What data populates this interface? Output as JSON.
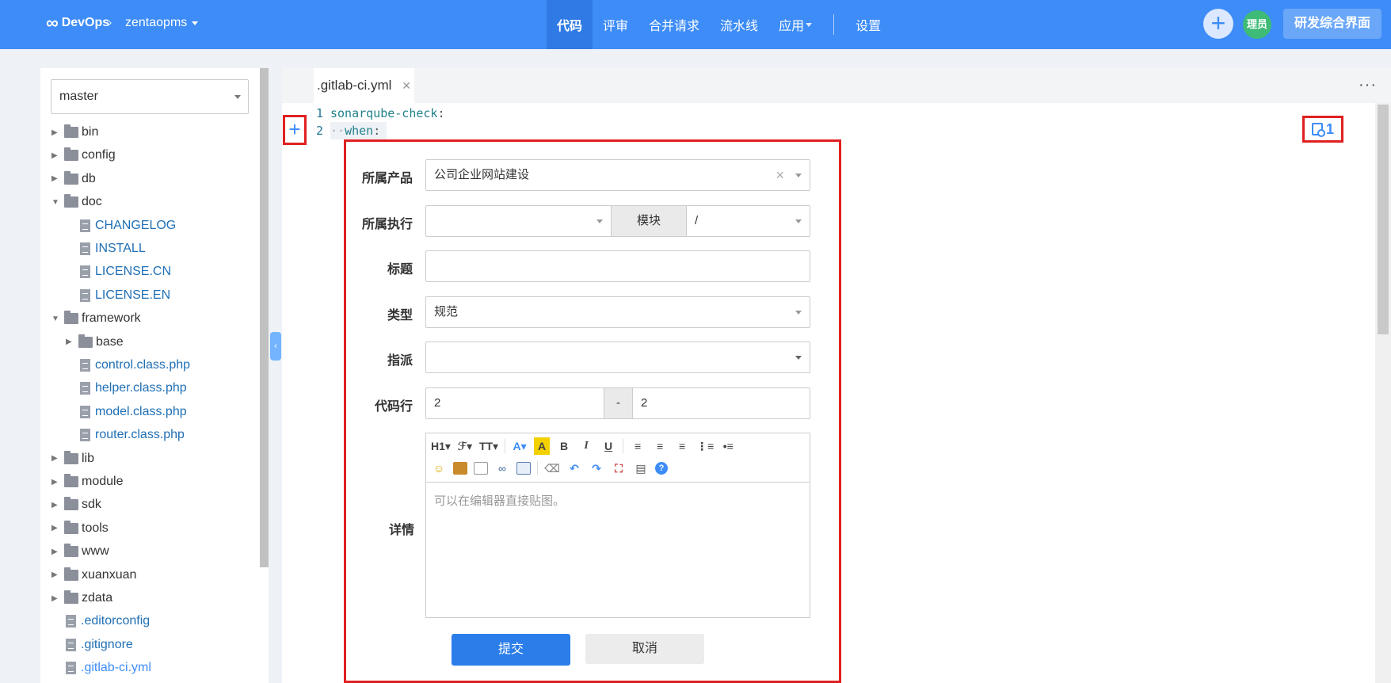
{
  "topbar": {
    "brand": "DevOps",
    "project": "zentaopms",
    "nav": [
      "代码",
      "评审",
      "合并请求",
      "流水线",
      "应用"
    ],
    "settings": "设置",
    "avatar": "理员",
    "rd_button": "研发综合界面"
  },
  "sidebar": {
    "branch": "master",
    "tree": [
      {
        "label": "bin",
        "kind": "folder",
        "open": false
      },
      {
        "label": "config",
        "kind": "folder",
        "open": false
      },
      {
        "label": "db",
        "kind": "folder",
        "open": false
      },
      {
        "label": "doc",
        "kind": "folder",
        "open": true
      },
      {
        "label": "CHANGELOG",
        "kind": "file"
      },
      {
        "label": "INSTALL",
        "kind": "file"
      },
      {
        "label": "LICENSE.CN",
        "kind": "file"
      },
      {
        "label": "LICENSE.EN",
        "kind": "file"
      },
      {
        "label": "framework",
        "kind": "folder",
        "open": true
      },
      {
        "label": "base",
        "kind": "folder",
        "open": false
      },
      {
        "label": "control.class.php",
        "kind": "file"
      },
      {
        "label": "helper.class.php",
        "kind": "file"
      },
      {
        "label": "model.class.php",
        "kind": "file"
      },
      {
        "label": "router.class.php",
        "kind": "file"
      },
      {
        "label": "lib",
        "kind": "folder",
        "open": false
      },
      {
        "label": "module",
        "kind": "folder",
        "open": false
      },
      {
        "label": "sdk",
        "kind": "folder",
        "open": false
      },
      {
        "label": "tools",
        "kind": "folder",
        "open": false
      },
      {
        "label": "www",
        "kind": "folder",
        "open": false
      },
      {
        "label": "xuanxuan",
        "kind": "folder",
        "open": false
      },
      {
        "label": "zdata",
        "kind": "folder",
        "open": false
      },
      {
        "label": ".editorconfig",
        "kind": "file"
      },
      {
        "label": ".gitignore",
        "kind": "file"
      },
      {
        "label": ".gitlab-ci.yml",
        "kind": "file",
        "active": true
      }
    ]
  },
  "editor": {
    "tab": ".gitlab-ci.yml",
    "more": "···",
    "lines": [
      {
        "no": "1",
        "key": "sonarqube-check",
        "rest": ":"
      },
      {
        "no": "2",
        "indent": "··",
        "key": "when",
        "rest": ":"
      }
    ],
    "issue_count": "1"
  },
  "form": {
    "product_label": "所属产品",
    "product_value": "公司企业网站建设",
    "execution_label": "所属执行",
    "execution_value": "",
    "module_label": "模块",
    "module_value": "/",
    "title_label": "标题",
    "title_value": "",
    "type_label": "类型",
    "type_value": "规范",
    "assign_label": "指派",
    "assign_value": "",
    "lines_label": "代码行",
    "line_start": "2",
    "line_sep": "-",
    "line_end": "2",
    "detail_label": "详情",
    "detail_placeholder": "可以在编辑器直接贴图。",
    "submit": "提交",
    "cancel": "取消"
  },
  "colors": {
    "topbar": "#3d8cf7",
    "accent": "#2b7de9",
    "highlight_border": "#e02020"
  }
}
